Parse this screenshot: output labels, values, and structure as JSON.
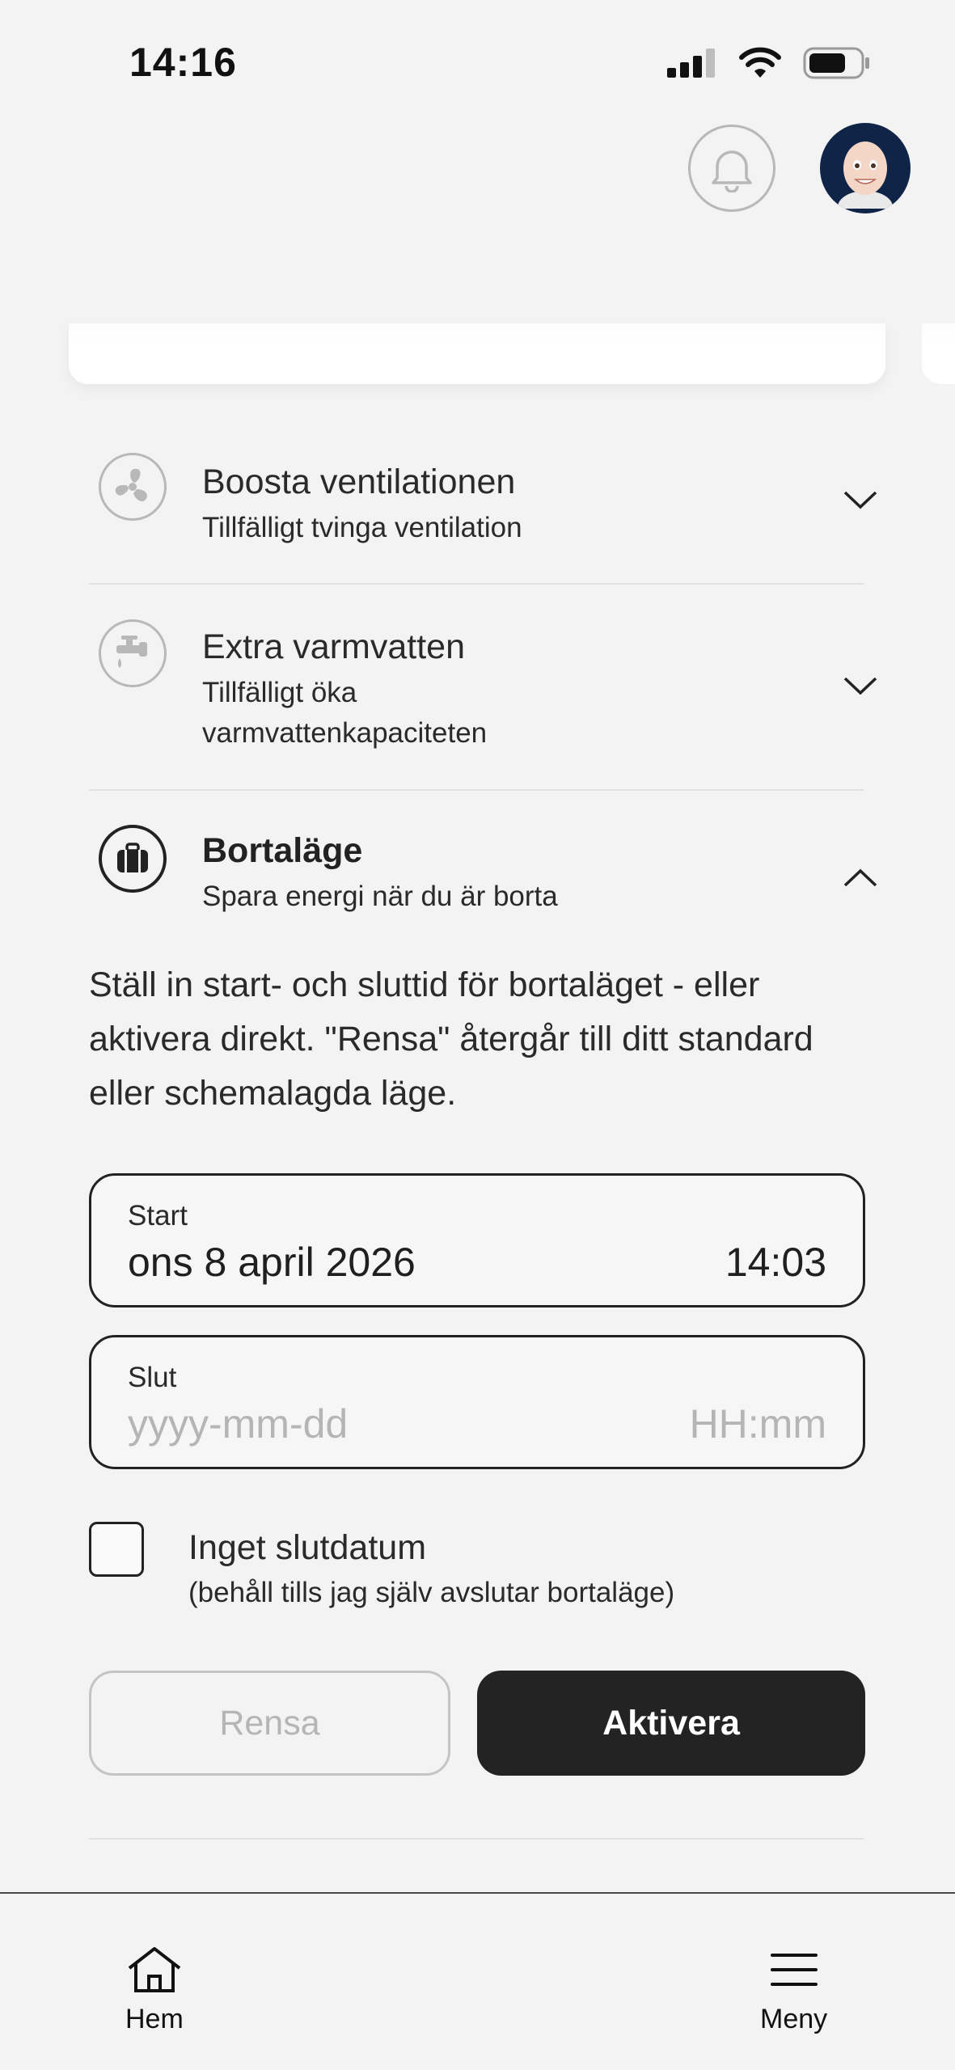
{
  "status_bar": {
    "time": "14:16"
  },
  "header": {
    "notifications_icon": "bell-icon",
    "avatar_icon": "memoji-avatar"
  },
  "accordion": [
    {
      "icon": "fan-icon",
      "title": "Boosta ventilationen",
      "subtitle": "Tillfälligt tvinga ventilation",
      "expanded": false
    },
    {
      "icon": "faucet-icon",
      "title": "Extra varmvatten",
      "subtitle_line1": "Tillfälligt öka",
      "subtitle_line2": "varmvattenkapaciteten",
      "expanded": false
    },
    {
      "icon": "suitcase-icon",
      "title": "Bortaläge",
      "subtitle": "Spara energi när du är borta",
      "expanded": true
    }
  ],
  "away_mode": {
    "description": "Ställ in start- och sluttid för bortaläget - eller aktivera direkt. \"Rensa\" återgår till ditt standard eller schemalagda läge.",
    "start": {
      "label": "Start",
      "date_value": "ons 8 april 2026",
      "time_value": "14:03"
    },
    "end": {
      "label": "Slut",
      "date_placeholder": "yyyy-mm-dd",
      "time_placeholder": "HH:mm"
    },
    "no_end_date": {
      "label": "Inget slutdatum",
      "sublabel": "(behåll tills jag själv avslutar bortaläge)",
      "checked": false
    },
    "clear_label": "Rensa",
    "activate_label": "Aktivera"
  },
  "bottom_nav": {
    "home_label": "Hem",
    "menu_label": "Meny"
  },
  "colors": {
    "background": "#f3f3f3",
    "primary_button": "#232323",
    "disabled_text": "#b5b5b5",
    "icon_border": "#b8b8b8"
  }
}
